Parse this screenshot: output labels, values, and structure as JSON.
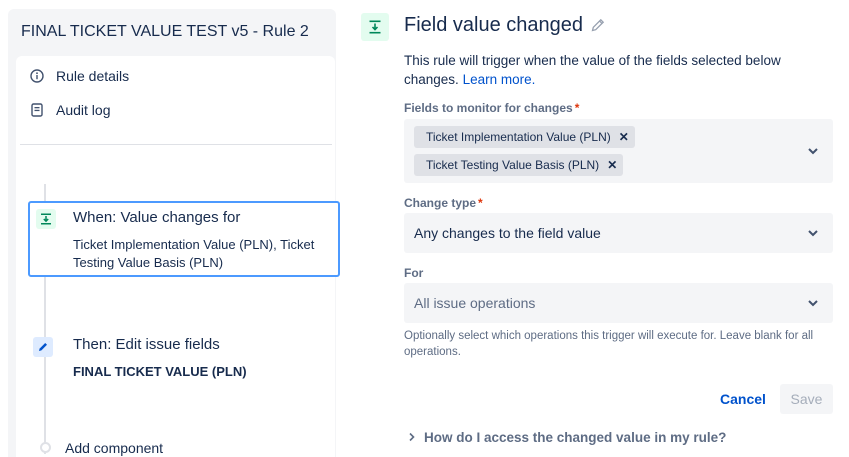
{
  "left": {
    "rule_title": "FINAL TICKET VALUE TEST v5 - Rule 2",
    "menu": [
      {
        "label": "Rule details",
        "icon": "info-icon"
      },
      {
        "label": "Audit log",
        "icon": "document-icon"
      }
    ],
    "trigger": {
      "title": "When: Value changes for",
      "description": "Ticket Implementation Value (PLN), Ticket Testing Value Basis (PLN)",
      "icon": "field-changed-icon"
    },
    "action": {
      "title": "Then: Edit issue fields",
      "subtitle": "FINAL TICKET VALUE (PLN)",
      "icon": "pencil-icon"
    },
    "add_component": "Add component"
  },
  "right": {
    "title": "Field value changed",
    "description": "This rule will trigger when the value of the fields selected below changes.",
    "learn_more": "Learn more.",
    "fields_label": "Fields to monitor for changes",
    "fields_selected": [
      "Ticket Implementation Value (PLN)",
      "Ticket Testing Value Basis (PLN)"
    ],
    "change_type_label": "Change type",
    "change_type_value": "Any changes to the field value",
    "for_label": "For",
    "for_placeholder": "All issue operations",
    "helper_text": "Optionally select which operations this trigger will execute for. Leave blank for all operations.",
    "cancel_label": "Cancel",
    "save_label": "Save",
    "expander_label": "How do I access the changed value in my rule?",
    "required_mark": "*"
  },
  "colors": {
    "accent": "#0052cc",
    "trigger_bg": "#e3fcef",
    "trigger_icon": "#00875a",
    "selected_border": "#4c9aff",
    "required": "#de350b"
  }
}
